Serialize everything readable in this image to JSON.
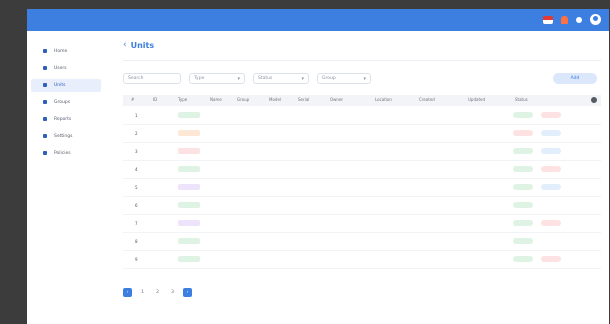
{
  "header": {
    "icons": [
      "flag-icon",
      "bell-icon",
      "lang-icon",
      "user-avatar-icon"
    ]
  },
  "sidebar": {
    "items": [
      {
        "label": "Home",
        "active": false
      },
      {
        "label": "Users",
        "active": false
      },
      {
        "label": "Units",
        "active": true
      },
      {
        "label": "Groups",
        "active": false
      },
      {
        "label": "Reports",
        "active": false
      },
      {
        "label": "Settings",
        "active": false
      },
      {
        "label": "Policies",
        "active": false
      }
    ]
  },
  "page": {
    "title": "Units",
    "subtitle": "",
    "back_icon": "chevron-left-icon"
  },
  "filters": [
    {
      "placeholder": "Search",
      "width": 58,
      "has_chevron": false
    },
    {
      "placeholder": "Type",
      "width": 56,
      "has_chevron": true
    },
    {
      "placeholder": "Status",
      "width": 56,
      "has_chevron": true
    },
    {
      "placeholder": "Group",
      "width": 54,
      "has_chevron": true
    }
  ],
  "add_button": "Add",
  "table": {
    "columns": [
      "#",
      "ID",
      "Type",
      "Name",
      "Group",
      "Model",
      "Serial",
      "Owner",
      "Location",
      "Created",
      "Updated",
      "Status"
    ],
    "rows": [
      {
        "n": "1",
        "id": "",
        "tag": {
          "text": "",
          "bg": "#dff3e4",
          "fg": "#2e9e4f"
        },
        "c": [
          "",
          "",
          "",
          "",
          "",
          "",
          "",
          "",
          ""
        ],
        "pills": [
          {
            "t": "",
            "bg": "#dff3e4",
            "fg": "#2e9e4f"
          },
          {
            "t": "",
            "bg": "#fde2e4",
            "fg": "#e04a5a"
          }
        ]
      },
      {
        "n": "2",
        "id": "",
        "tag": {
          "text": "",
          "bg": "#fde8d6",
          "fg": "#e07a2e"
        },
        "c": [
          "",
          "",
          "",
          "",
          "",
          "",
          "",
          "",
          ""
        ],
        "pills": [
          {
            "t": "",
            "bg": "#fde2e4",
            "fg": "#e04a5a"
          },
          {
            "t": "",
            "bg": "#e3eefc",
            "fg": "#3d7fe0"
          }
        ]
      },
      {
        "n": "3",
        "id": "",
        "tag": {
          "text": "",
          "bg": "#fde2e4",
          "fg": "#e04a5a"
        },
        "c": [
          "",
          "",
          "",
          "",
          "",
          "",
          "",
          "",
          ""
        ],
        "pills": [
          {
            "t": "",
            "bg": "#dff3e4",
            "fg": "#2e9e4f"
          },
          {
            "t": "",
            "bg": "#e3eefc",
            "fg": "#3d7fe0"
          }
        ]
      },
      {
        "n": "4",
        "id": "",
        "tag": {
          "text": "",
          "bg": "#dff3e4",
          "fg": "#2e9e4f"
        },
        "c": [
          "",
          "",
          "",
          "",
          "",
          "",
          "",
          "",
          ""
        ],
        "pills": [
          {
            "t": "",
            "bg": "#dff3e4",
            "fg": "#2e9e4f"
          },
          {
            "t": "",
            "bg": "#fde2e4",
            "fg": "#e04a5a"
          }
        ]
      },
      {
        "n": "5",
        "id": "",
        "tag": {
          "text": "",
          "bg": "#ede4fb",
          "fg": "#8a5ad9"
        },
        "c": [
          "",
          "",
          "",
          "",
          "",
          "",
          "",
          "",
          ""
        ],
        "pills": [
          {
            "t": "",
            "bg": "#dff3e4",
            "fg": "#2e9e4f"
          },
          {
            "t": "",
            "bg": "#e3eefc",
            "fg": "#3d7fe0"
          }
        ]
      },
      {
        "n": "6",
        "id": "",
        "tag": {
          "text": "",
          "bg": "#dff3e4",
          "fg": "#2e9e4f"
        },
        "c": [
          "",
          "",
          "",
          "",
          "",
          "",
          "",
          "",
          ""
        ],
        "pills": [
          {
            "t": "",
            "bg": "#dff3e4",
            "fg": "#2e9e4f"
          },
          null
        ]
      },
      {
        "n": "7",
        "id": "",
        "tag": {
          "text": "",
          "bg": "#ede4fb",
          "fg": "#8a5ad9"
        },
        "c": [
          "",
          "",
          "",
          "",
          "",
          "",
          "",
          "",
          ""
        ],
        "pills": [
          {
            "t": "",
            "bg": "#dff3e4",
            "fg": "#2e9e4f"
          },
          {
            "t": "",
            "bg": "#fde2e4",
            "fg": "#e04a5a"
          }
        ]
      },
      {
        "n": "8",
        "id": "",
        "tag": {
          "text": "",
          "bg": "#dff3e4",
          "fg": "#2e9e4f"
        },
        "c": [
          "",
          "",
          "",
          "",
          "",
          "",
          "",
          "",
          ""
        ],
        "pills": [
          {
            "t": "",
            "bg": "#dff3e4",
            "fg": "#2e9e4f"
          },
          null
        ]
      },
      {
        "n": "9",
        "id": "",
        "tag": {
          "text": "",
          "bg": "#dff3e4",
          "fg": "#2e9e4f"
        },
        "c": [
          "",
          "",
          "",
          "",
          "",
          "",
          "",
          "",
          ""
        ],
        "pills": [
          {
            "t": "",
            "bg": "#dff3e4",
            "fg": "#2e9e4f"
          },
          {
            "t": "",
            "bg": "#fde2e4",
            "fg": "#e04a5a"
          }
        ]
      }
    ]
  },
  "pagination": {
    "pages": [
      "1",
      "2",
      "3"
    ],
    "info": ""
  }
}
